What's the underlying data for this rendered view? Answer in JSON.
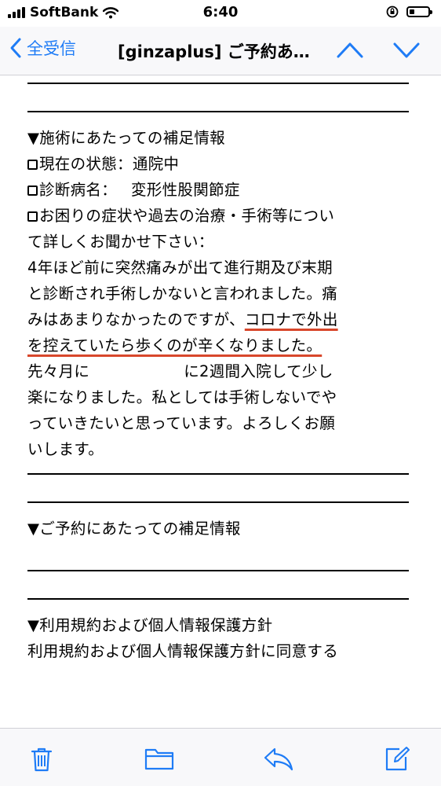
{
  "status_bar": {
    "carrier": "SoftBank",
    "time": "6:40"
  },
  "nav": {
    "back_label": "全受信",
    "title": "[ginzaplus] ご予約あ…"
  },
  "email_body": {
    "section1_heading": "▼施術にあたっての補足情報",
    "item_status_label": "現在の状態：",
    "item_status_value": "通院中",
    "item_diagnosis_label": "診断病名：",
    "item_diagnosis_value": "変形性股関節症",
    "item_symptoms_line1": "お困りの症状や過去の治療・手術等につい",
    "item_symptoms_line2": "て詳しくお聞かせ下さい：",
    "body_line1": "4年ほど前に突然痛みが出て進行期及び末期",
    "body_line2": "と診断され手術しかないと言われました。痛",
    "body_line3_a": "みはあまりなかったのですが、",
    "body_line3_b": "コロナで外出",
    "body_line4_a": "を控えていたら歩くのが辛くなりました。",
    "body_line5_a": "先々月に",
    "body_line5_b": "に2週間入院して少し",
    "body_line6": "楽になりました。私としては手術しないでや",
    "body_line7": "っていきたいと思っています。よろしくお願",
    "body_line8": "いします。",
    "section2_heading": "▼ご予約にあたっての補足情報",
    "section3_heading": "▼利用規約および個人情報保護方針",
    "section3_text": "利用規約および個人情報保護方針に同意する"
  },
  "colors": {
    "ios_blue": "#1f7cf6",
    "underline_red": "#d8472b"
  },
  "toolbar_icons": [
    "trash-icon",
    "folder-icon",
    "reply-icon",
    "compose-icon"
  ]
}
